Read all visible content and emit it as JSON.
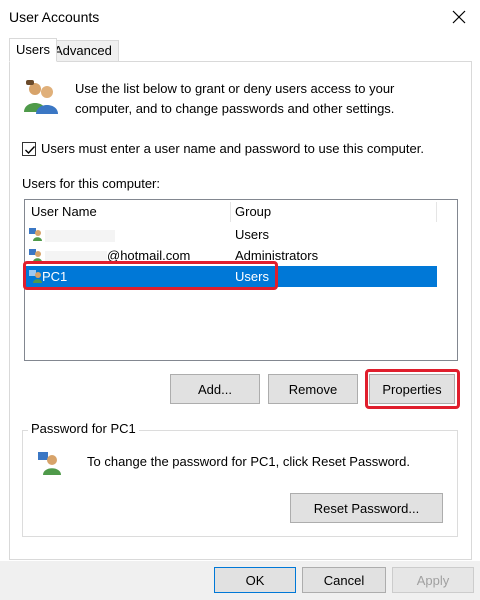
{
  "window": {
    "title": "User Accounts"
  },
  "tabs": [
    {
      "label": "Users",
      "active": true
    },
    {
      "label": "Advanced",
      "active": false
    }
  ],
  "intro": {
    "text": "Use the list below to grant or deny users access to your computer, and to change passwords and other settings."
  },
  "require_password": {
    "label": "Users must enter a user name and password to use this computer.",
    "checked": true
  },
  "users_list": {
    "label": "Users for this computer:",
    "columns": [
      "User Name",
      "Group"
    ],
    "rows": [
      {
        "name": "",
        "group": "Users",
        "selected": false
      },
      {
        "name": "@hotmail.com",
        "group": "Administrators",
        "selected": false
      },
      {
        "name": "PC1",
        "group": "Users",
        "selected": true
      }
    ]
  },
  "buttons": {
    "add": "Add...",
    "remove": "Remove",
    "properties": "Properties",
    "reset_password": "Reset Password...",
    "ok": "OK",
    "cancel": "Cancel",
    "apply": "Apply"
  },
  "password_group": {
    "label": "Password for PC1",
    "text": "To change the password for PC1, click Reset Password."
  },
  "colors": {
    "selection": "#0078d7",
    "highlight": "#e01e2d"
  }
}
